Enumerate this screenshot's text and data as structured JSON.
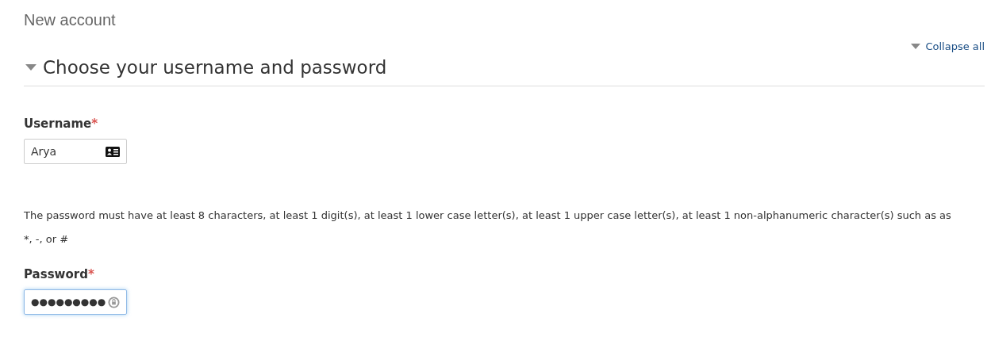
{
  "page_title": "New account",
  "collapse_all": {
    "label": "Collapse all"
  },
  "section": {
    "title": "Choose your username and password",
    "expanded": true
  },
  "username": {
    "label": "Username",
    "required_mark": "*",
    "value": "Arya"
  },
  "password_policy": "The password must have at least 8 characters, at least 1 digit(s), at least 1 lower case letter(s), at least 1 upper case letter(s), at least 1 non-alphanumeric character(s) such as as *, -, or #",
  "password": {
    "label": "Password",
    "required_mark": "*",
    "value": "●●●●●●●●●",
    "focused": true
  }
}
